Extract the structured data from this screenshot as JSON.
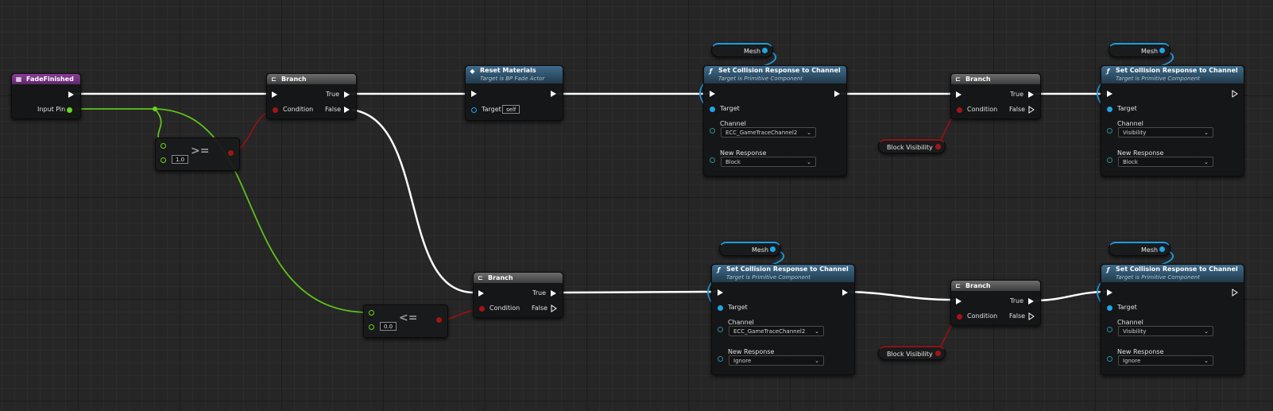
{
  "event_node": {
    "title": "FadeFinished",
    "input_pin": "Input Pin"
  },
  "branch": {
    "title": "Branch",
    "true_label": "True",
    "false_label": "False",
    "condition_label": "Condition"
  },
  "compare_ge": {
    "operator": ">=",
    "value": "1.0"
  },
  "compare_le": {
    "operator": "<=",
    "value": "0.0"
  },
  "reset_materials": {
    "title": "Reset Materials",
    "subtitle": "Target is BP Fade Actor",
    "target_label": "Target",
    "target_value": "self"
  },
  "set_collision": {
    "title": "Set Collision Response to Channel",
    "subtitle": "Target is Primitive Component",
    "target_label": "Target",
    "channel_label": "Channel",
    "response_label": "New Response"
  },
  "mesh_var": "Mesh",
  "block_visibility_var": "Block Visibility",
  "channels": {
    "game_trace": "ECC_GameTraceChannel2",
    "visibility": "Visibility"
  },
  "responses": {
    "block": "Block",
    "ignore": "Ignore"
  },
  "colors": {
    "exec": "#ffffff",
    "bool": "#a31515",
    "float": "#6ad41e",
    "object": "#1ea6e6",
    "event_header": "#8a3c98",
    "func_header": "#3f6c8c"
  },
  "icons": {
    "event": "event-icon",
    "branch": "branch-icon",
    "function": "function-icon"
  }
}
